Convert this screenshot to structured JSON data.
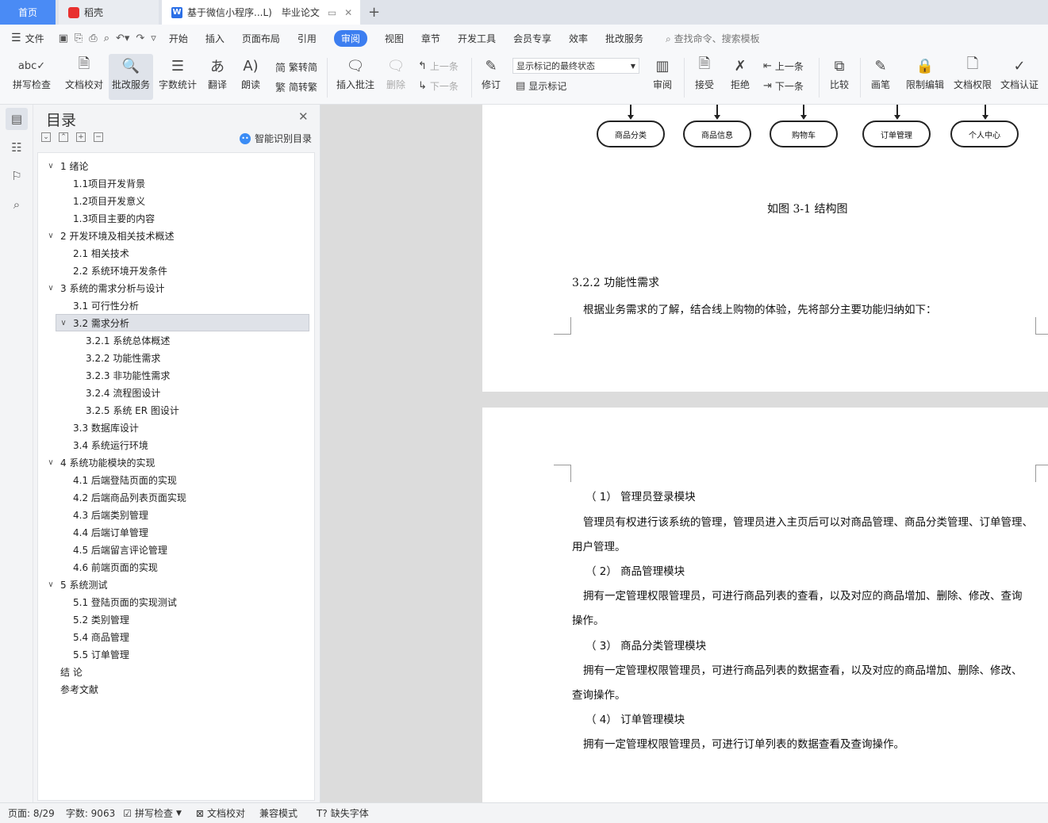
{
  "tabs": {
    "home": "首页",
    "daoke": "稻壳",
    "doc": "基于微信小程序...L)",
    "doc_sub": "毕业论文",
    "add": "+"
  },
  "menu": {
    "file": "文件",
    "tabs": [
      "开始",
      "插入",
      "页面布局",
      "引用",
      "审阅",
      "视图",
      "章节",
      "开发工具",
      "会员专享",
      "效率",
      "批改服务"
    ],
    "active_tab": "审阅",
    "search_placeholder": "查找命令、搜索模板"
  },
  "ribbon": {
    "spell": "拼写检查",
    "proof": "文档校对",
    "correct": "批改服务",
    "wordcount": "字数统计",
    "translate": "翻译",
    "read": "朗读",
    "trad": "繁转简",
    "simp": "简转繁",
    "insert_comment": "插入批注",
    "delete": "删除",
    "prev": "上一条",
    "next": "下一条",
    "revise": "修订",
    "markup_state": "显示标记的最终状态",
    "show_markup": "显示标记",
    "review": "审阅",
    "accept": "接受",
    "reject": "拒绝",
    "prev2": "上一条",
    "next2": "下一条",
    "compare": "比较",
    "pen": "画笔",
    "restrict": "限制编辑",
    "permission": "文档权限",
    "cert": "文档认证"
  },
  "toc": {
    "title": "目录",
    "smart": "智能识别目录",
    "items": [
      {
        "label": "1  绪论",
        "level": 1,
        "chev": "∨"
      },
      {
        "label": "1.1项目开发背景",
        "level": 2
      },
      {
        "label": "1.2项目开发意义",
        "level": 2
      },
      {
        "label": "1.3项目主要的内容",
        "level": 2
      },
      {
        "label": "2  开发环境及相关技术概述",
        "level": 1,
        "chev": "∨"
      },
      {
        "label": "2.1  相关技术",
        "level": 2
      },
      {
        "label": "2.2  系统环境开发条件",
        "level": 2
      },
      {
        "label": "3  系统的需求分析与设计",
        "level": 1,
        "chev": "∨"
      },
      {
        "label": "3.1 可行性分析",
        "level": 2
      },
      {
        "label": "3.2 需求分析",
        "level": 2,
        "chev": "∨",
        "selected": true
      },
      {
        "label": "3.2.1 系统总体概述",
        "level": 3
      },
      {
        "label": "3.2.2 功能性需求",
        "level": 3
      },
      {
        "label": "3.2.3 非功能性需求",
        "level": 3
      },
      {
        "label": "3.2.4 流程图设计",
        "level": 3
      },
      {
        "label": "3.2.5 系统 ER 图设计",
        "level": 3
      },
      {
        "label": "3.3  数据库设计",
        "level": 2
      },
      {
        "label": "3.4 系统运行环境",
        "level": 2
      },
      {
        "label": "4  系统功能模块的实现",
        "level": 1,
        "chev": "∨"
      },
      {
        "label": "4.1  后端登陆页面的实现",
        "level": 2
      },
      {
        "label": "4.2 后端商品列表页面实现",
        "level": 2
      },
      {
        "label": "4.3  后端类别管理",
        "level": 2
      },
      {
        "label": "4.4  后端订单管理",
        "level": 2
      },
      {
        "label": "4.5  后端留言评论管理",
        "level": 2
      },
      {
        "label": "4.6  前端页面的实现",
        "level": 2
      },
      {
        "label": "5  系统测试",
        "level": 1,
        "chev": "∨"
      },
      {
        "label": "5.1  登陆页面的实现测试",
        "level": 2
      },
      {
        "label": "5.2  类别管理",
        "level": 2
      },
      {
        "label": "5.4  商品管理",
        "level": 2
      },
      {
        "label": "5.5  订单管理",
        "level": 2
      },
      {
        "label": "结    论",
        "level": 1
      },
      {
        "label": "参考文献",
        "level": 1
      }
    ]
  },
  "document": {
    "nodes": [
      "商品分类",
      "商品信息",
      "购物车",
      "订单管理",
      "个人中心"
    ],
    "caption": "如图 3-1 结构图",
    "heading": "3.2.2 功能性需求",
    "intro": "根据业务需求的了解，结合线上购物的体验，先将部分主要功能归纳如下：",
    "m1_title": "（ 1）  管理员登录模块",
    "m1_text1": "管理员有权进行该系统的管理，管理员进入主页后可以对商品管理、商品分类管理、订单管理、",
    "m1_text2": "用户管理。",
    "m2_title": "（ 2）  商品管理模块",
    "m2_text1": "拥有一定管理权限管理员，可进行商品列表的查看，以及对应的商品增加、删除、修改、查询",
    "m2_text2": "操作。",
    "m3_title": "（ 3）  商品分类管理模块",
    "m3_text1": "拥有一定管理权限管理员，可进行商品列表的数据查看，以及对应的商品增加、删除、修改、",
    "m3_text2": "查询操作。",
    "m4_title": "（ 4）  订单管理模块",
    "m4_text1": "拥有一定管理权限管理员，可进行订单列表的数据查看及查询操作。"
  },
  "status": {
    "page": "页面: 8/29",
    "words": "字数: 9063",
    "spell": "拼写检查",
    "proof": "文档校对",
    "compat": "兼容模式",
    "missing_font": "缺失字体"
  }
}
